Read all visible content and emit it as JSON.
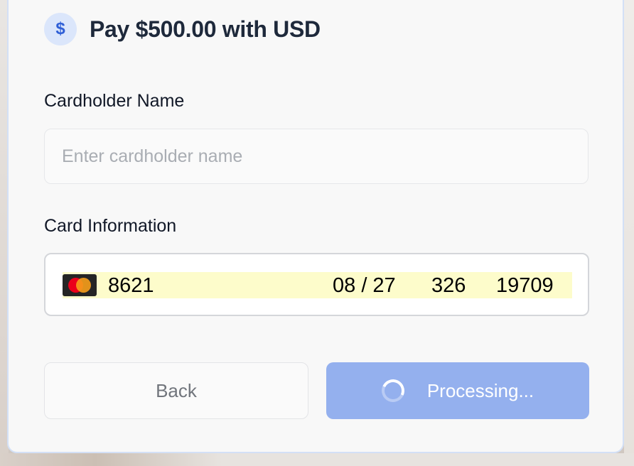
{
  "payment": {
    "currency_icon": "dollar-icon",
    "title": "Pay $500.00 with USD"
  },
  "cardholder": {
    "label": "Cardholder Name",
    "placeholder": "Enter cardholder name",
    "value": ""
  },
  "card_information": {
    "label": "Card Information",
    "brand_icon": "mastercard-icon",
    "number_last4": "8621",
    "expiry": "08 / 27",
    "cvc": "326",
    "zip": "19709",
    "autofill_highlight_color": "#fdfccb"
  },
  "actions": {
    "back_label": "Back",
    "processing_label": "Processing...",
    "processing_button_color": "#94b0ee",
    "processing_icon": "spinner-icon"
  },
  "colors": {
    "accent": "#2f5fd6",
    "card_border": "#d3e0f6"
  }
}
